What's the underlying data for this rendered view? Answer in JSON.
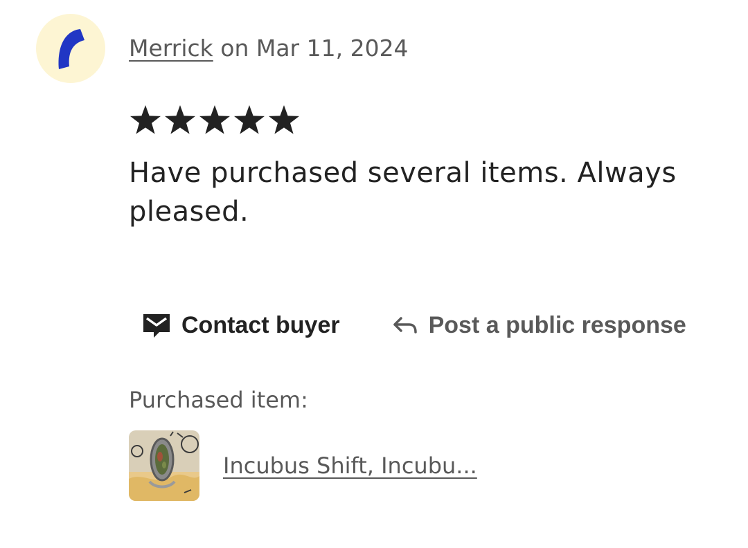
{
  "review": {
    "author": "Merrick",
    "date_text": " on Mar 11, 2024",
    "rating": 5,
    "rating_max": 5,
    "text": "Have purchased several items. Always pleased."
  },
  "actions": {
    "contact_label": "Contact buyer",
    "respond_label": "Post a public response"
  },
  "purchased": {
    "label": "Purchased item:",
    "item_title": "Incubus Shift, Incubu..."
  },
  "icons": {
    "avatar": "avatar-crescent-icon",
    "star": "star-icon",
    "contact": "message-icon",
    "respond": "reply-arrow-icon"
  },
  "colors": {
    "avatar_bg": "#fdf5d3",
    "avatar_mark": "#2136c4",
    "text_primary": "#222222",
    "text_secondary": "#595959"
  }
}
